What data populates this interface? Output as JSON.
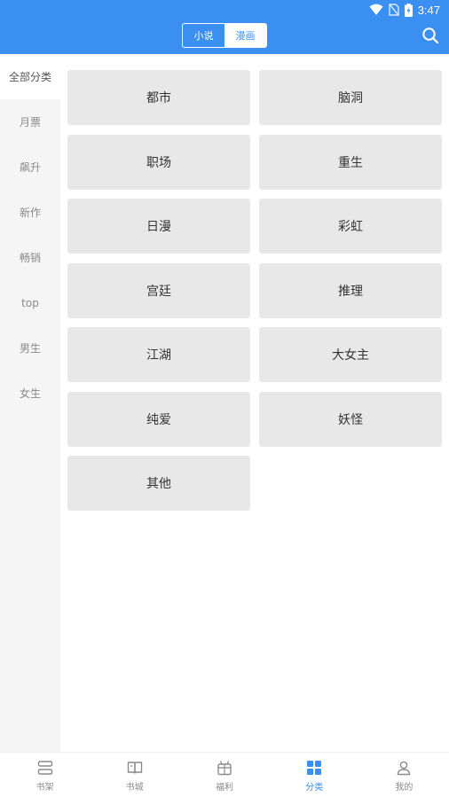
{
  "status": {
    "time": "3:47"
  },
  "header": {
    "segments": [
      {
        "label": "小说",
        "active": false
      },
      {
        "label": "漫画",
        "active": true
      }
    ],
    "accent": "#3a8ff0"
  },
  "sidenav": {
    "items": [
      {
        "label": "全部分类"
      },
      {
        "label": "月票"
      },
      {
        "label": "飙升"
      },
      {
        "label": "新作"
      },
      {
        "label": "畅销"
      },
      {
        "label": "top"
      },
      {
        "label": "男生"
      },
      {
        "label": "女生"
      }
    ]
  },
  "categories": [
    {
      "label": "都市"
    },
    {
      "label": "脑洞"
    },
    {
      "label": "职场"
    },
    {
      "label": "重生"
    },
    {
      "label": "日漫"
    },
    {
      "label": "彩虹"
    },
    {
      "label": "宫廷"
    },
    {
      "label": "推理"
    },
    {
      "label": "江湖"
    },
    {
      "label": "大女主"
    },
    {
      "label": "纯爱"
    },
    {
      "label": "妖怪"
    },
    {
      "label": "其他"
    }
  ],
  "tabbar": {
    "tabs": [
      {
        "label": "书架",
        "icon": "bookshelf-icon"
      },
      {
        "label": "书城",
        "icon": "open-book-icon"
      },
      {
        "label": "福利",
        "icon": "gift-icon"
      },
      {
        "label": "分类",
        "icon": "grid-icon"
      },
      {
        "label": "我的",
        "icon": "user-icon"
      }
    ]
  }
}
